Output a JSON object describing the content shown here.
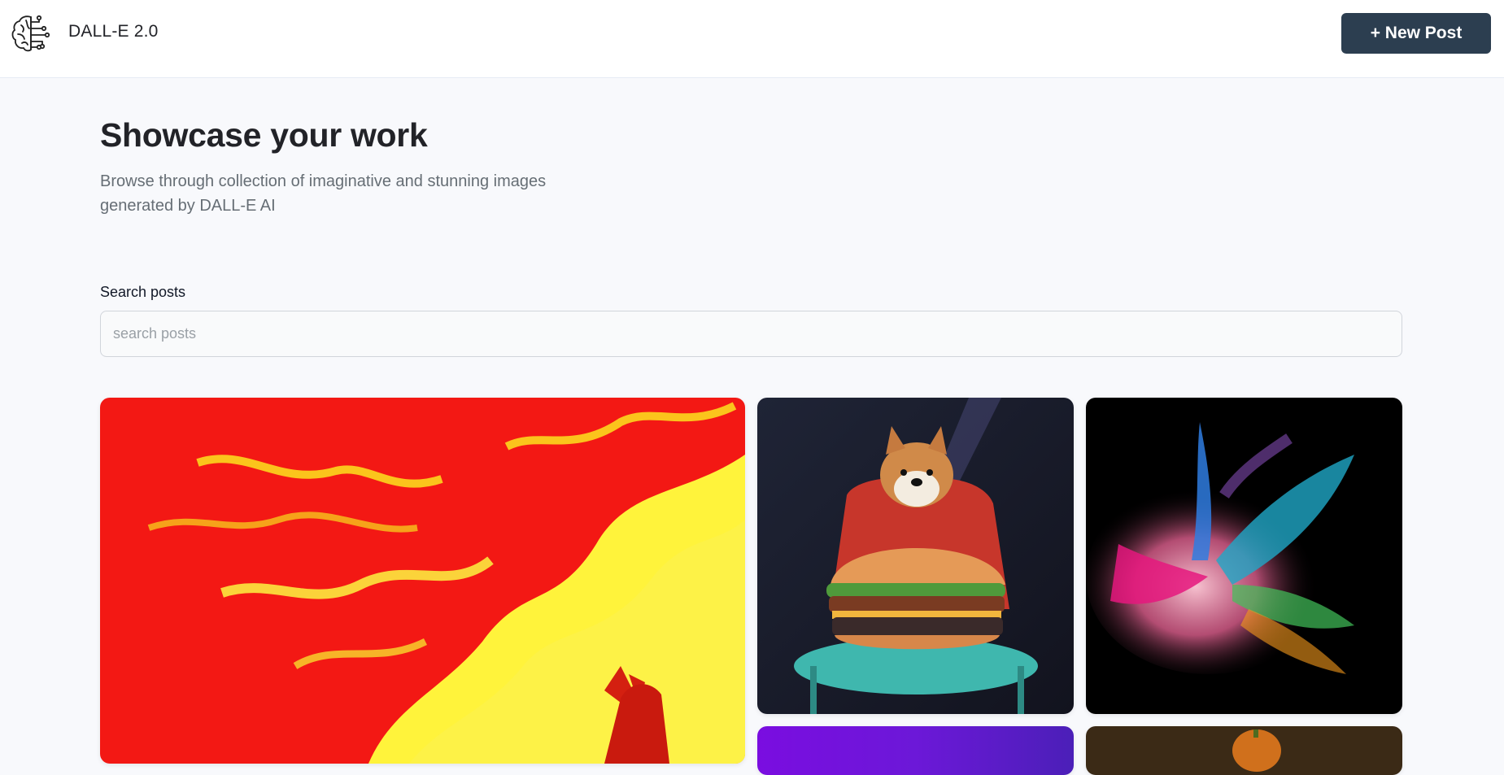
{
  "header": {
    "app_name": "DALL-E 2.0",
    "logo_icon": "brain-circuit-icon",
    "new_post_label": "+ New Post"
  },
  "hero": {
    "title": "Showcase your work",
    "subtitle": "Browse through collection of imaginative and stunning images generated by DALL-E AI"
  },
  "search": {
    "label": "Search posts",
    "placeholder": "search posts",
    "value": ""
  },
  "colors": {
    "accent_button": "#2c3e50",
    "page_background": "#f8f9fc",
    "title_text": "#222328",
    "subtitle_text": "#666e75"
  }
}
